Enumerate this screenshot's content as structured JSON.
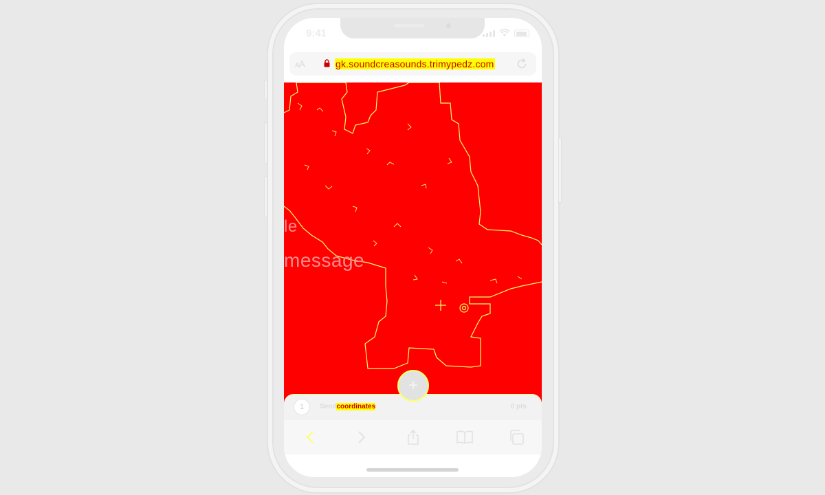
{
  "status": {
    "time": "9:41"
  },
  "browser": {
    "text_size_label": "AA",
    "url": "gk.soundcreasounds.trimypedz.com"
  },
  "hero": {
    "line1": "le",
    "line2": "message"
  },
  "fab": {
    "label": "+"
  },
  "send": {
    "avatar_initial": "1",
    "label_prefix": "Send",
    "label_highlight": "coordinates",
    "count": "0 pts"
  },
  "colors": {
    "content_bg": "#ff0000",
    "highlight": "#ffff00",
    "frame": "#ebebeb"
  },
  "icons": [
    "lock-icon",
    "reload-icon",
    "back-icon",
    "forward-icon",
    "share-icon",
    "bookmarks-icon",
    "tabs-icon"
  ]
}
